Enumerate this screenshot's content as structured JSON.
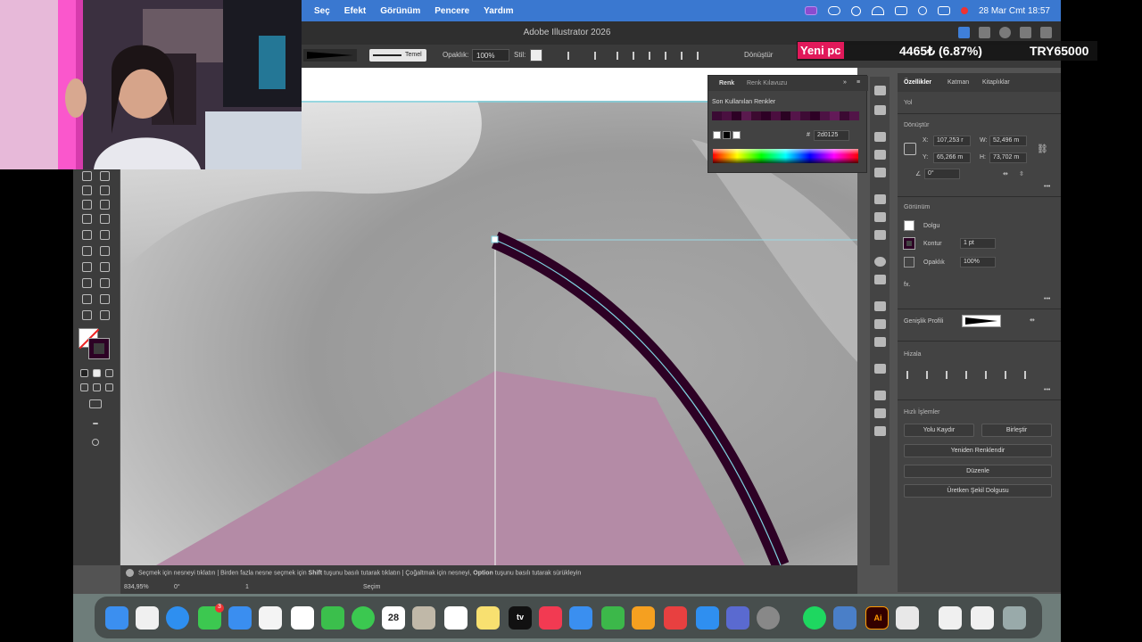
{
  "menubar": {
    "items": [
      "Seç",
      "Efekt",
      "Görünüm",
      "Pencere",
      "Yardım"
    ],
    "datetime": "28 Mar Cmt  18:57"
  },
  "window": {
    "title": "Adobe Illustrator 2026"
  },
  "controlbar": {
    "stroke_style": "Temel",
    "opacity_label": "Opaklık:",
    "opacity_value": "100%",
    "style_label": "Stil:",
    "transform_label": "Dönüştür"
  },
  "color_panel": {
    "tab_color": "Renk",
    "tab_guide": "Renk Kılavuzu",
    "recent_label": "Son Kullanılan Renkler",
    "hex_value": "2d0125",
    "recent_swatches": [
      "#3a0a33",
      "#4a1040",
      "#2d0125",
      "#5a1a4e",
      "#3c0a30",
      "#2d0125",
      "#4b0e3f",
      "#2a0322",
      "#55154a",
      "#3e0b35",
      "#2d0125",
      "#4d1244",
      "#631a58",
      "#3b0a32",
      "#521548"
    ]
  },
  "properties": {
    "tabs": [
      "Özellikler",
      "Katman",
      "Kitaplıklar"
    ],
    "tab_layers": "Katman",
    "object_type": "Yol",
    "transform_title": "Dönüştür",
    "x_label": "X:",
    "x_value": "107,253 r",
    "y_label": "Y:",
    "y_value": "65,266 m",
    "w_label": "W:",
    "w_value": "52,496 m",
    "h_label": "H:",
    "h_value": "73,702 m",
    "angle_value": "0°",
    "appearance_title": "Görünüm",
    "fill_label": "Dolgu",
    "stroke_label": "Kontur",
    "stroke_value": "1 pt",
    "opacity_label": "Opaklık",
    "opacity_value": "100%",
    "fx_label": "fx.",
    "width_profile_label": "Genişlik Profili",
    "align_title": "Hizala",
    "quick_actions_title": "Hızlı İşlemler",
    "btn_offset_path": "Yolu Kaydır",
    "btn_merge": "Birleştir",
    "btn_recolor": "Yeniden Renklendir",
    "btn_arrange": "Düzenle",
    "btn_generative_fill": "Üretken Şekil Dolgusu"
  },
  "statusbar": {
    "hint_1a": "Seçmek için nesneyi tıklatın",
    "hint_2a": "Birden fazla nesne seçmek için ",
    "hint_2b": "Shift",
    "hint_2c": " tuşunu basılı tutarak tıklatın",
    "hint_3a": "Çoğaltmak için nesneyi, ",
    "hint_3b": "Option",
    "hint_3c": " tuşunu basılı tutarak sürükleyin",
    "zoom": "834,95%",
    "rotation": "0°",
    "artboard": "1",
    "tool": "Seçim"
  },
  "dock": {
    "calendar_day": "28",
    "messages_badge": "3",
    "ai_label": "Ai",
    "tv_label": "tv"
  },
  "ticker": {
    "tag": "Yeni pc",
    "value": "4465₺ (6.87%)",
    "goal": "TRY65000"
  },
  "colors": {
    "stroke": "#2d0125",
    "pink_fill": "#b48ba6",
    "menubar": "#3a78d0",
    "guide": "#7fd3e0"
  }
}
